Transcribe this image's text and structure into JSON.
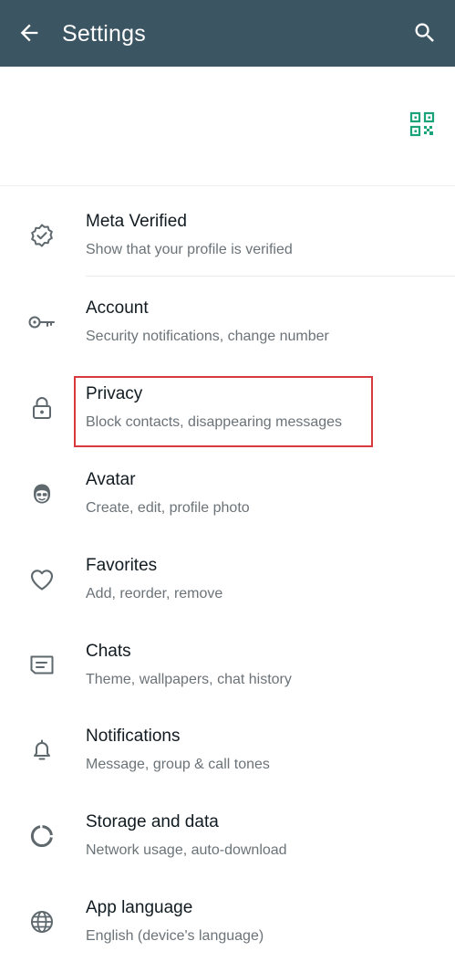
{
  "header": {
    "title": "Settings",
    "back_icon": "arrow-left-icon",
    "search_icon": "search-icon",
    "background_color": "#3c5562"
  },
  "profile": {
    "qr_icon": "qr-code-icon",
    "qr_color": "#1aa37a"
  },
  "settings_items": [
    {
      "label": "Meta Verified",
      "subtitle": "Show that your profile is verified",
      "icon": "verified-badge-icon"
    },
    {
      "label": "Account",
      "subtitle": "Security notifications, change number",
      "icon": "key-icon"
    },
    {
      "label": "Privacy",
      "subtitle": "Block contacts, disappearing messages",
      "icon": "lock-icon",
      "highlighted": true
    },
    {
      "label": "Avatar",
      "subtitle": "Create, edit, profile photo",
      "icon": "avatar-face-icon"
    },
    {
      "label": "Favorites",
      "subtitle": "Add, reorder, remove",
      "icon": "heart-icon"
    },
    {
      "label": "Chats",
      "subtitle": "Theme, wallpapers, chat history",
      "icon": "chat-icon"
    },
    {
      "label": "Notifications",
      "subtitle": "Message, group & call tones",
      "icon": "bell-icon"
    },
    {
      "label": "Storage and data",
      "subtitle": "Network usage, auto-download",
      "icon": "storage-circle-icon"
    },
    {
      "label": "App language",
      "subtitle": "English (device's language)",
      "icon": "globe-icon"
    }
  ],
  "highlight_color": "#d7393e"
}
